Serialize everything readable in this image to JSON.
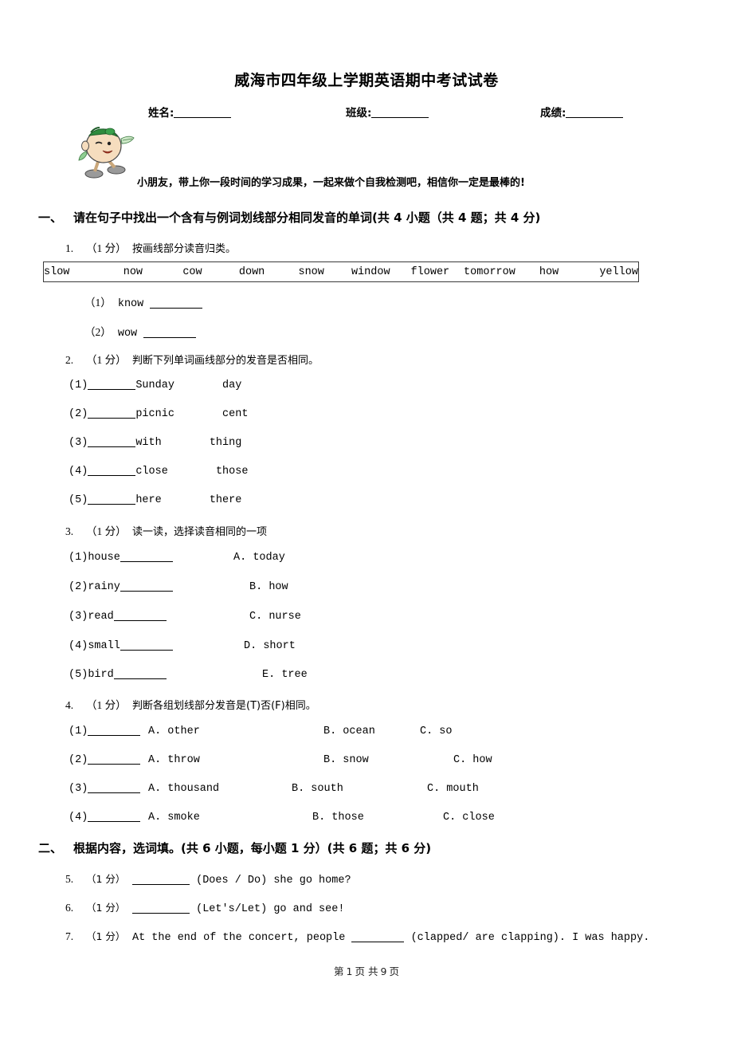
{
  "document": {
    "title": "威海市四年级上学期英语期中考试试卷",
    "meta": [
      {
        "label": "姓名:",
        "value": ""
      },
      {
        "label": "班级:",
        "value": ""
      },
      {
        "label": "成绩:",
        "value": ""
      }
    ],
    "tagline": "小朋友，带上你一段时间的学习成果，一起来做个自我检测吧，相信你一定是最棒的!",
    "mascot_alt": "cartoon-egg-mascot"
  },
  "sections": [
    {
      "number": "一、",
      "title": "请在句子中找出一个含有与例词划线部分相同发音的单词(共 4 小题（共 4 题；共 4 分)"
    },
    {
      "number": "二、",
      "title": "根据内容，选词填。(共 6 小题，每小题 1 分）(共 6 题；共 6 分)"
    }
  ],
  "questions": {
    "q1": {
      "no": "1.",
      "points": "（1 分）",
      "text": "按画线部分读音归类。",
      "wordbank": [
        "slow",
        "now",
        "cow",
        "down",
        "snow",
        "window",
        "flower",
        "tomorrow",
        "how",
        "yellow"
      ],
      "items": [
        {
          "label": "（1）",
          "word": "know"
        },
        {
          "label": "（2）",
          "word": "wow"
        }
      ]
    },
    "q2": {
      "no": "2.",
      "points": "（1 分）",
      "text": "判断下列单词画线部分的发音是否相同。",
      "items": [
        {
          "label": "(1)",
          "a": "Sunday",
          "b": "day"
        },
        {
          "label": "(2)",
          "a": "picnic",
          "b": "cent"
        },
        {
          "label": "(3)",
          "a": "with",
          "b": "thing"
        },
        {
          "label": "(4)",
          "a": "close",
          "b": "those"
        },
        {
          "label": "(5)",
          "a": "here",
          "b": "there"
        }
      ]
    },
    "q3": {
      "no": "3.",
      "points": "（1 分）",
      "text": "读一读，选择读音相同的一项",
      "items": [
        {
          "label": "(1)",
          "word": "house"
        },
        {
          "label": "(2)",
          "word": "rainy"
        },
        {
          "label": "(3)",
          "word": "read"
        },
        {
          "label": "(4)",
          "word": "small"
        },
        {
          "label": "(5)",
          "word": "bird"
        }
      ],
      "options": [
        {
          "key": "A.",
          "value": "today"
        },
        {
          "key": "B.",
          "value": "how"
        },
        {
          "key": "C.",
          "value": "nurse"
        },
        {
          "key": "D.",
          "value": "short"
        },
        {
          "key": "E.",
          "value": "tree"
        }
      ]
    },
    "q4": {
      "no": "4.",
      "points": "（1 分）",
      "text": "判断各组划线部分发音是(T)否(F)相同。",
      "items": [
        {
          "label": "(1)",
          "a": "A. other",
          "b": "B. ocean",
          "c": "C. so"
        },
        {
          "label": "(2)",
          "a": "A. throw",
          "b": "B. snow",
          "c": "C. how"
        },
        {
          "label": "(3)",
          "a": "A. thousand",
          "b": "B. south",
          "c": "C. mouth"
        },
        {
          "label": "(4)",
          "a": "A. smoke",
          "b": "B. those",
          "c": "C. close"
        }
      ]
    },
    "q5": {
      "no": "5.",
      "points": "（1 分）",
      "after_blank": "(Does / Do) she go home?"
    },
    "q6": {
      "no": "6.",
      "points": "（1 分）",
      "after_blank": "(Let's/Let) go and see!"
    },
    "q7": {
      "no": "7.",
      "points": "（1 分）",
      "before_blank": "At the end of the concert, people",
      "after_blank": "(clapped/ are clapping). I was happy."
    }
  },
  "footer": {
    "prefix": "第",
    "page": "1",
    "middle": "页 共",
    "total": "9",
    "suffix": "页"
  }
}
